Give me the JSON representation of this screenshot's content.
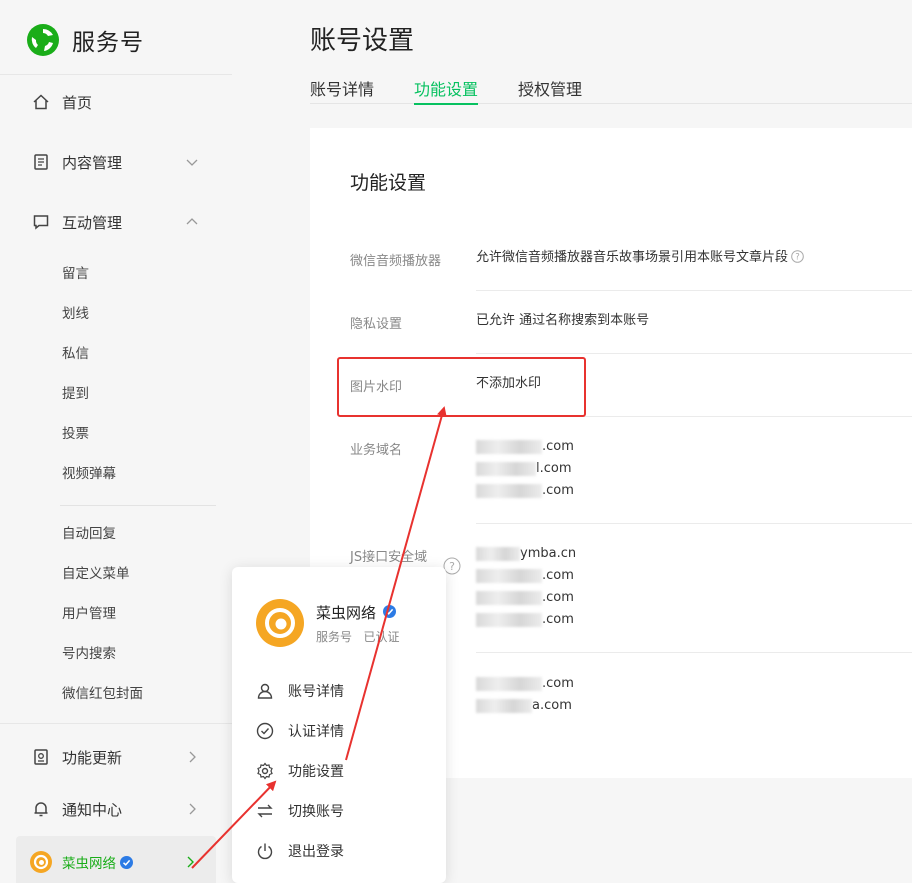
{
  "brand": {
    "name": "服务号"
  },
  "sidebar": {
    "home": "首页",
    "content_mgmt": "内容管理",
    "interaction_mgmt": "互动管理",
    "sub_items": [
      "留言",
      "划线",
      "私信",
      "提到",
      "投票",
      "视频弹幕"
    ],
    "sub_items_2": [
      "自动回复",
      "自定义菜单",
      "用户管理",
      "号内搜索",
      "微信红包封面"
    ],
    "feature_updates": "功能更新",
    "notifications": "通知中心",
    "account_name": "菜虫网络"
  },
  "page": {
    "title": "账号设置",
    "tabs": [
      "账号详情",
      "功能设置",
      "授权管理"
    ],
    "active_tab": "功能设置"
  },
  "settings": {
    "title": "功能设置",
    "rows": [
      {
        "label": "微信音频播放器",
        "value": "允许微信音频播放器音乐故事场景引用本账号文章片段"
      },
      {
        "label": "隐私设置",
        "value": "已允许 通过名称搜索到本账号"
      },
      {
        "label": "图片水印",
        "value": "不添加水印"
      },
      {
        "label": "业务域名",
        "domains": [
          ".com",
          "l.com",
          ".com"
        ]
      },
      {
        "label": "JS接口安全域",
        "domains": [
          "ymba.cn",
          ".com",
          ".com",
          ".com"
        ]
      },
      {
        "label": "",
        "domains": [
          ".com",
          "a.com"
        ]
      }
    ]
  },
  "popup": {
    "account_name": "菜虫网络",
    "account_type": "服务号",
    "account_status": "已认证",
    "menu": [
      "账号详情",
      "认证详情",
      "功能设置",
      "切换账号",
      "退出登录"
    ]
  },
  "colors": {
    "accent": "#07c160",
    "highlight": "#e8322f",
    "avatar": "#f5a623"
  }
}
